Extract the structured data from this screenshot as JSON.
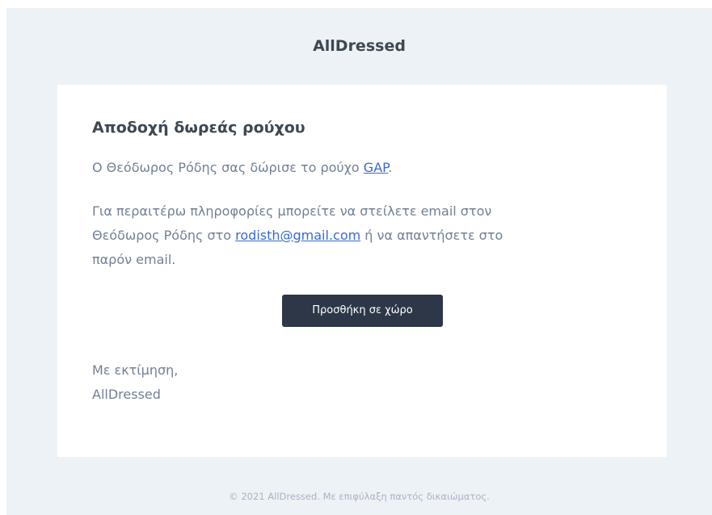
{
  "header": {
    "brand": "AllDressed"
  },
  "email": {
    "heading": "Αποδοχή δωρεάς ρούχου",
    "p1_before": "Ο Θεόδωρος Ρόδης σας δώρισε το ρούχο ",
    "p1_link": "GAP",
    "p1_after": ".",
    "p2_line1": "Για περαιτέρω πληροφορίες μπορείτε να στείλετε email στον",
    "p2_line2_before": "Θεόδωρος Ρόδης στο ",
    "p2_email": "rodisth@gmail.com",
    "p2_line2_after": " ή να απαντήσετε στο",
    "p2_line3": "παρόν email.",
    "button_label": "Προσθήκη σε χώρο",
    "closing": "Με εκτίμηση,",
    "signature": "AllDressed"
  },
  "footer": {
    "copyright": "© 2021 AllDressed. Με επιφύλαξη παντός δικαιώματος."
  },
  "colors": {
    "background": "#edf2f7",
    "card": "#ffffff",
    "heading_text": "#3d4852",
    "body_text": "#718096",
    "link": "#3869d4",
    "button": "#2d3748",
    "footer_text": "#b0adc5"
  }
}
